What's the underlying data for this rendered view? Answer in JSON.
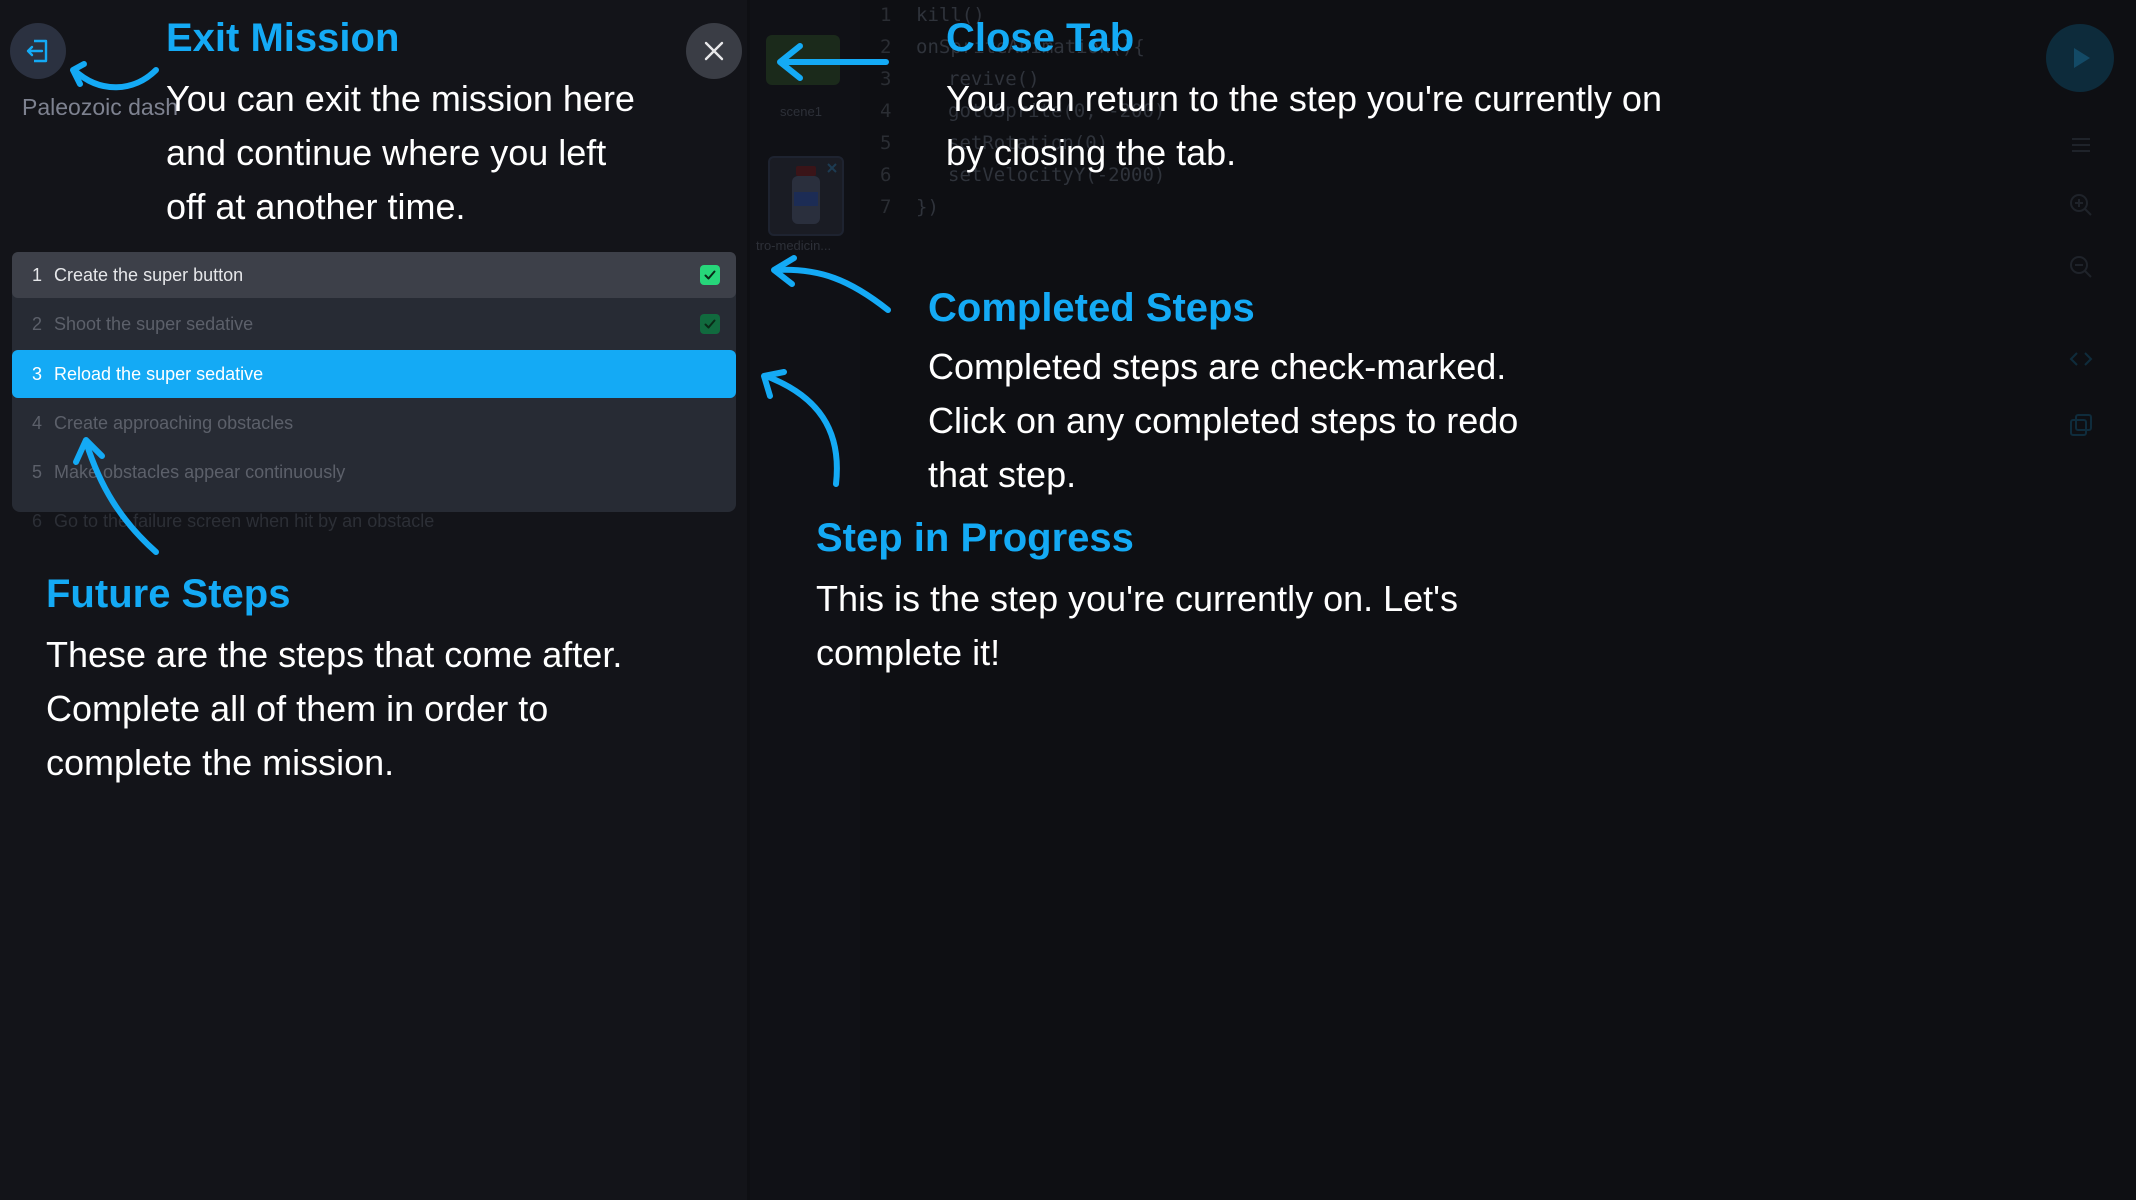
{
  "mission": {
    "title": "Paleozoic dash",
    "exit_icon": "exit-door-icon",
    "close_icon": "close-icon"
  },
  "steps": [
    {
      "number": "1",
      "label": "Create the super button",
      "status": "completed"
    },
    {
      "number": "2",
      "label": "Shoot the super sedative",
      "status": "completed"
    },
    {
      "number": "3",
      "label": "Reload the super sedative",
      "status": "in-progress"
    },
    {
      "number": "4",
      "label": "Create approaching obstacles",
      "status": "future"
    },
    {
      "number": "5",
      "label": "Make obstacles appear continuously",
      "status": "future"
    },
    {
      "number": "6",
      "label": "Go to the failure screen when hit by an obstacle",
      "status": "future"
    }
  ],
  "editor": {
    "sprites": [
      {
        "label": "scene1"
      },
      {
        "label": "tro-medicin..."
      }
    ],
    "code_lines": [
      {
        "num": "1",
        "code": "kill()"
      },
      {
        "num": "2",
        "code": "onSpriteAnimation(){"
      },
      {
        "num": "3",
        "code": "revive()"
      },
      {
        "num": "4",
        "code": "gotoSprite(0, -200)"
      },
      {
        "num": "5",
        "code": "setRotation(0)"
      },
      {
        "num": "6",
        "code": "setVelocityY(-2000)"
      },
      {
        "num": "7",
        "code": "})"
      }
    ],
    "run_icon": "play-icon"
  },
  "annotations": {
    "exit_mission": {
      "title": "Exit Mission",
      "lines": [
        "You can exit the mission here",
        "and continue where you left",
        "off at another time."
      ]
    },
    "close_tab": {
      "title": "Close Tab",
      "lines": [
        "You can return to the step you're currently on",
        "by closing the tab."
      ]
    },
    "completed_steps": {
      "title": "Completed Steps",
      "lines": [
        "Completed steps are check-marked.",
        "Click on any completed steps to redo",
        "that step."
      ]
    },
    "step_in_progress": {
      "title": "Step in Progress",
      "lines": [
        "This is the step you're currently on. Let's",
        "complete it!"
      ]
    },
    "future_steps": {
      "title": "Future Steps",
      "lines": [
        "These are the steps that come after.",
        "Complete all of them in order to",
        "complete the mission."
      ]
    }
  },
  "colors": {
    "accent": "#14aaf5",
    "completed_check": "#27d67a",
    "panel": "#131419",
    "overlay_text": "#ffffff"
  }
}
